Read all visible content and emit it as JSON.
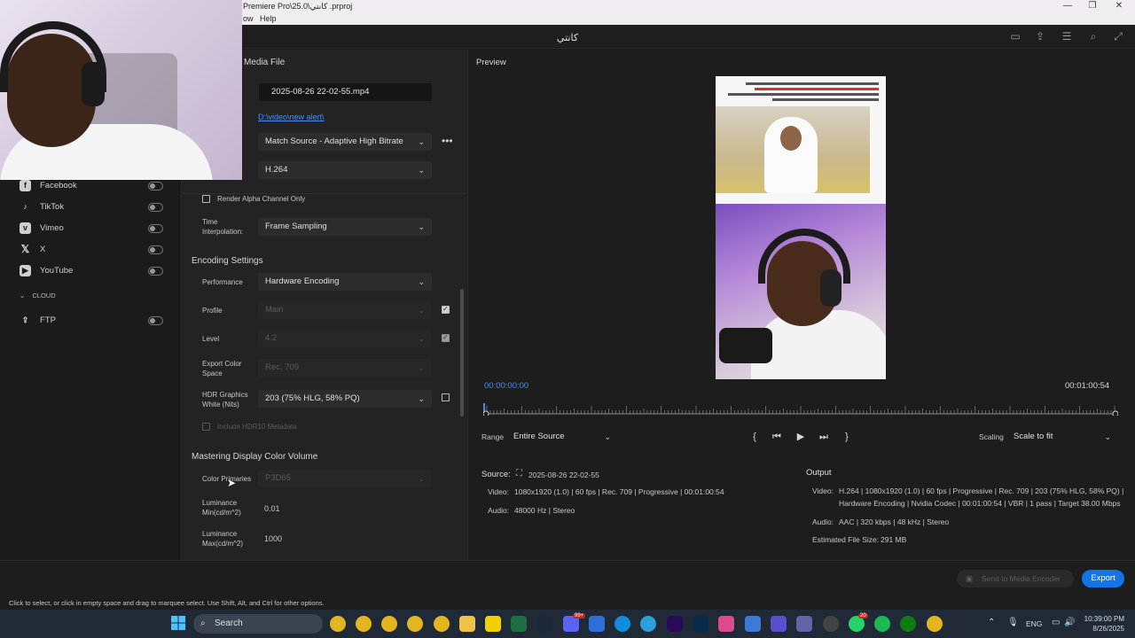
{
  "window": {
    "title": "Premiere Pro\\25.0\\كانتي .prproj",
    "menu_fragment": "ow",
    "menu_help": "Help",
    "app_title": "كانتي"
  },
  "destinations": [
    {
      "label": "Facebook",
      "icon": "facebook-icon"
    },
    {
      "label": "TikTok",
      "icon": "tiktok-icon"
    },
    {
      "label": "Vimeo",
      "icon": "vimeo-icon"
    },
    {
      "label": "X",
      "icon": "x-icon"
    },
    {
      "label": "YouTube",
      "icon": "youtube-icon"
    }
  ],
  "cloud": {
    "section": "CLOUD",
    "ftp": "FTP"
  },
  "settings": {
    "media_file_heading": "Media File",
    "file_name": "2025-08-26 22-02-55.mp4",
    "location": "D:\\video\\new alert\\",
    "preset": "Match Source - Adaptive High Bitrate",
    "format": "H.264",
    "render_alpha": "Render Alpha Channel Only",
    "time_interp_label": "Time Interpolation:",
    "time_interp_value": "Frame Sampling",
    "encoding_heading": "Encoding Settings",
    "performance_label": "Performance",
    "performance_value": "Hardware Encoding",
    "profile_label": "Profile",
    "profile_value": "Main",
    "level_label": "Level",
    "level_value": "4.2",
    "ecs_label": "Export Color Space",
    "ecs_value": "Rec. 709",
    "hdr_label": "HDR Graphics White (Nits)",
    "hdr_value": "203 (75% HLG, 58% PQ)",
    "hdr10": "Include HDR10 Metadata",
    "mastering_heading": "Mastering Display Color Volume",
    "primaries_label": "Color Primaries",
    "primaries_value": "P3D65",
    "lum_min_label": "Luminance Min(cd/m^2)",
    "lum_min_value": "0.01",
    "lum_max_label": "Luminance Max(cd/m^2)",
    "lum_max_value": "1000"
  },
  "preview": {
    "heading": "Preview",
    "timecode_start": "00:00:00:00",
    "timecode_end": "00:01:00:54",
    "range_label": "Range",
    "range_value": "Entire Source",
    "scaling_label": "Scaling",
    "scaling_value": "Scale to fit",
    "source_label": "Source:",
    "source_name": "2025-08-26 22-02-55",
    "src_video_label": "Video:",
    "src_video": "1080x1920 (1.0)  |  60 fps  |  Rec. 709  |  Progressive  |  00:01:00:54",
    "src_audio_label": "Audio:",
    "src_audio": "48000 Hz  |  Stereo",
    "output_label": "Output",
    "out_video_label": "Video:",
    "out_video_1": "H.264  |  1080x1920 (1.0)  |  60 fps  |  Progressive  |  Rec. 709  |  203 (75% HLG, 58% PQ)  |",
    "out_video_2": "Hardware Encoding  |  Nvidia Codec  |  00:01:00:54  |  VBR  |  1 pass  |  Target 38.00 Mbps",
    "out_audio_label": "Audio:",
    "out_audio": "AAC  |  320 kbps  |  48 kHz  |  Stereo",
    "est_label": "Estimated File Size:",
    "est_value": "291 MB"
  },
  "footer": {
    "send_label": "Send to Media Encoder",
    "export_label": "Export",
    "status": "Click to select, or click in empty space and drag to marquee select. Use Shift, Alt, and Ctrl for other options."
  },
  "taskbar": {
    "search": "Search",
    "lang": "ENG",
    "time": "10:39:00 PM",
    "date": "8/26/2025",
    "badge1": "99+",
    "badge2": "20"
  },
  "colors": {
    "accent": "#1473e6",
    "link": "#4d8ee8",
    "play_head": "#3f8ff0"
  }
}
